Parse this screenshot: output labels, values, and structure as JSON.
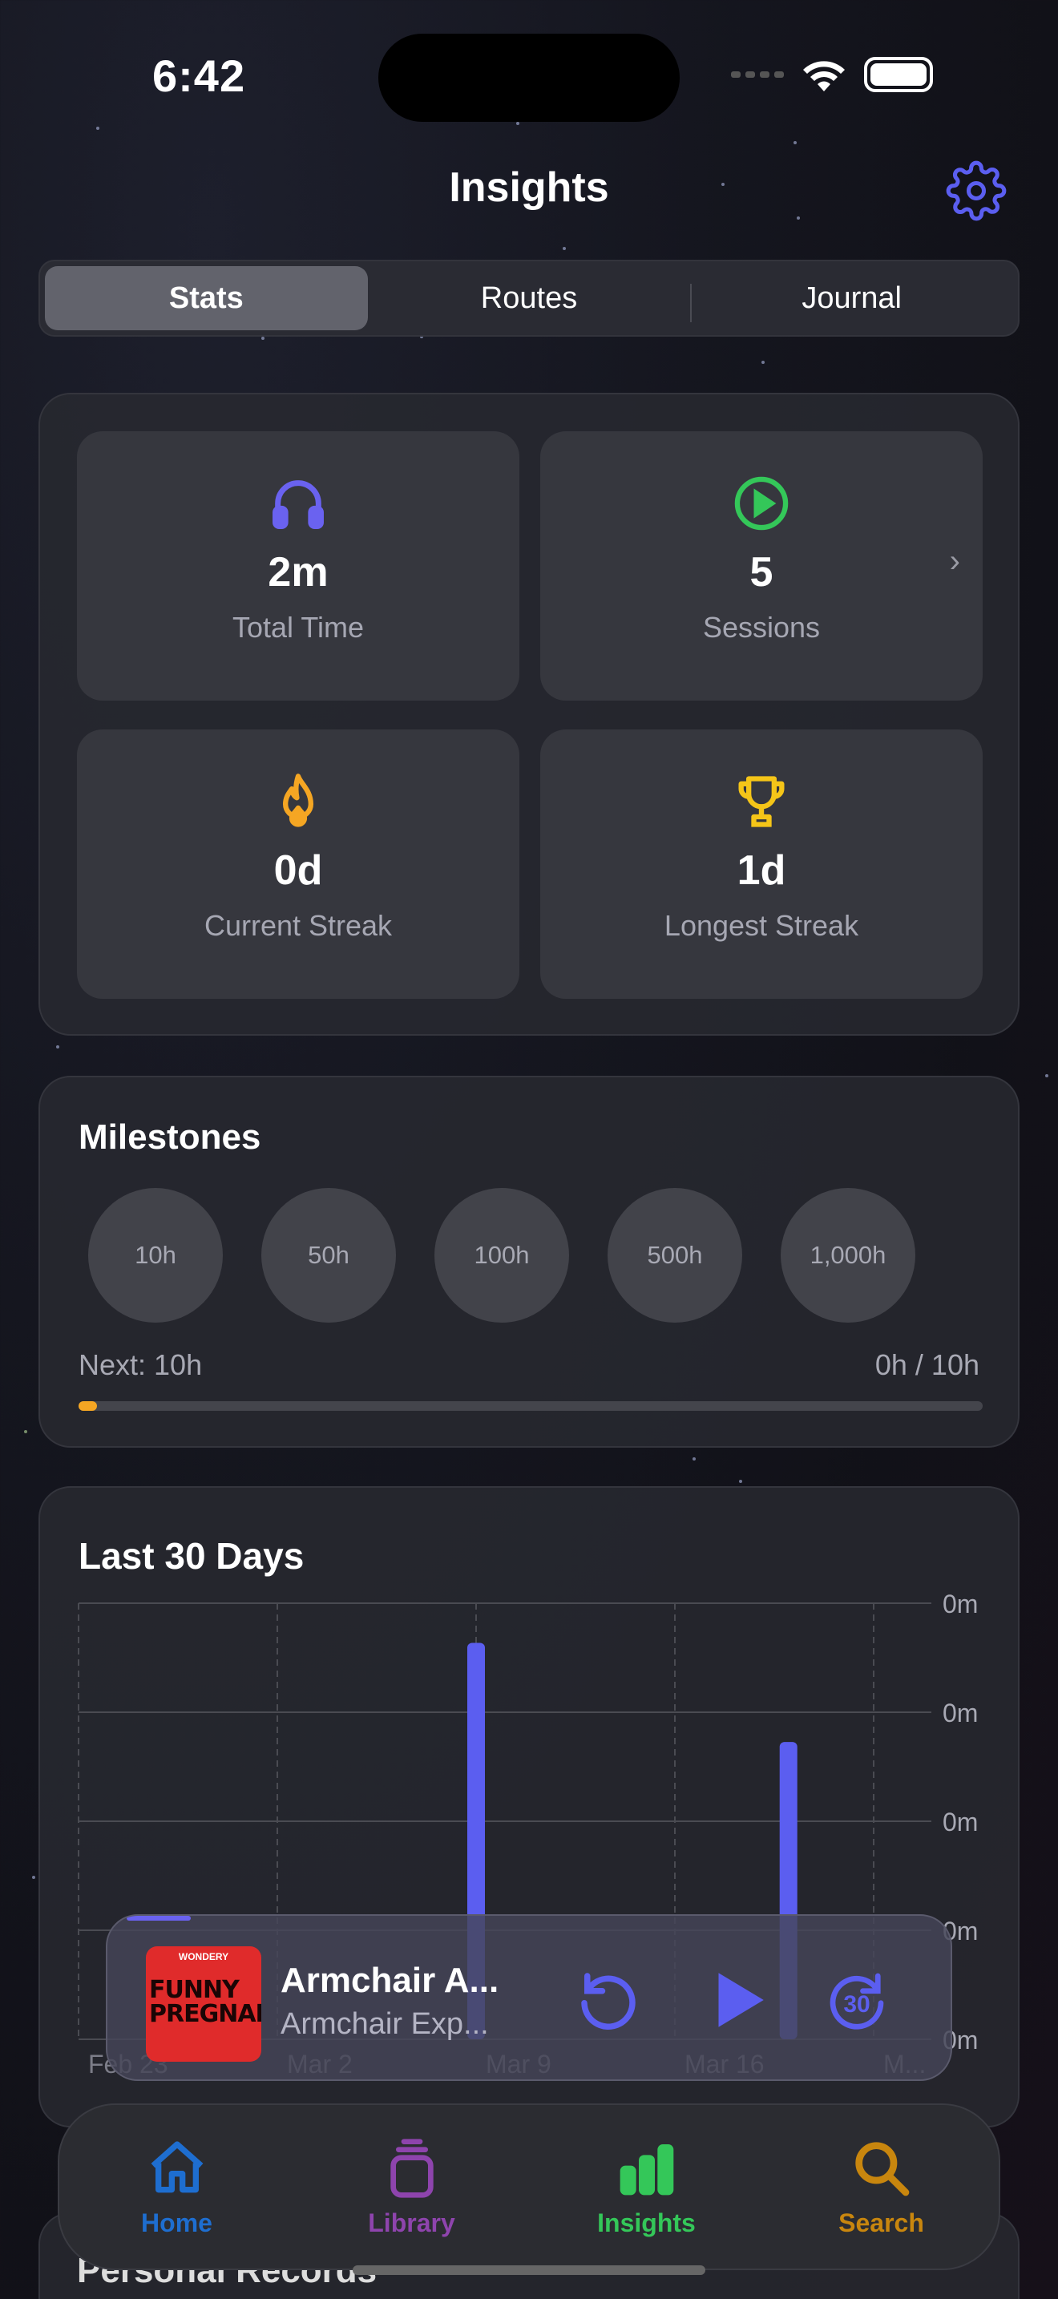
{
  "status": {
    "time": "6:42"
  },
  "header": {
    "title": "Insights",
    "settings_icon": "gear-icon",
    "accent": "#5b5ef0"
  },
  "segments": [
    {
      "label": "Stats",
      "active": true
    },
    {
      "label": "Routes",
      "active": false
    },
    {
      "label": "Journal",
      "active": false
    }
  ],
  "stats": [
    {
      "icon": "headphones-icon",
      "value": "2m",
      "label": "Total Time",
      "color": "#6a62f0"
    },
    {
      "icon": "play-circle-icon",
      "value": "5",
      "label": "Sessions",
      "color": "#34c759"
    },
    {
      "icon": "flame-icon",
      "value": "0d",
      "label": "Current Streak",
      "color": "#f5a623"
    },
    {
      "icon": "trophy-icon",
      "value": "1d",
      "label": "Longest Streak",
      "color": "#f5c518"
    }
  ],
  "milestones": {
    "title": "Milestones",
    "items": [
      "10h",
      "50h",
      "100h",
      "500h",
      "1,000h"
    ],
    "next_label": "Next: 10h",
    "progress_text": "0h / 10h",
    "progress_fraction": 0.02,
    "progress_color": "#f5a623"
  },
  "chart_data": {
    "type": "bar",
    "title": "Last 30 Days",
    "x_tick_labels": [
      "Feb 23",
      "Mar 2",
      "Mar 9",
      "Mar 16",
      "M..."
    ],
    "y_tick_labels": [
      "0m",
      "0m",
      "0m",
      "0m",
      "0m"
    ],
    "bars": [
      {
        "x": "Mar 9",
        "value": 1.0
      },
      {
        "x": "Mar 20",
        "value": 0.75
      }
    ],
    "ylim": [
      0,
      1.1
    ],
    "bar_color": "#5b5ef0",
    "grid": true
  },
  "player": {
    "art_brand": "WONDERY",
    "art_title": "FUNNY PREGNANCY",
    "title": "Armchair A...",
    "subtitle": "Armchair Exp...",
    "progress_fraction": 0.08,
    "skip_forward_label": "30"
  },
  "tabs": [
    {
      "label": "Home",
      "icon": "house-icon",
      "color": "#1e6ed0"
    },
    {
      "label": "Library",
      "icon": "library-icon",
      "color": "#8e44ad"
    },
    {
      "label": "Insights",
      "icon": "bar-chart-icon",
      "color": "#34c759"
    },
    {
      "label": "Search",
      "icon": "magnifier-icon",
      "color": "#c8860e"
    }
  ],
  "personal_records": {
    "title": "Personal Records"
  }
}
